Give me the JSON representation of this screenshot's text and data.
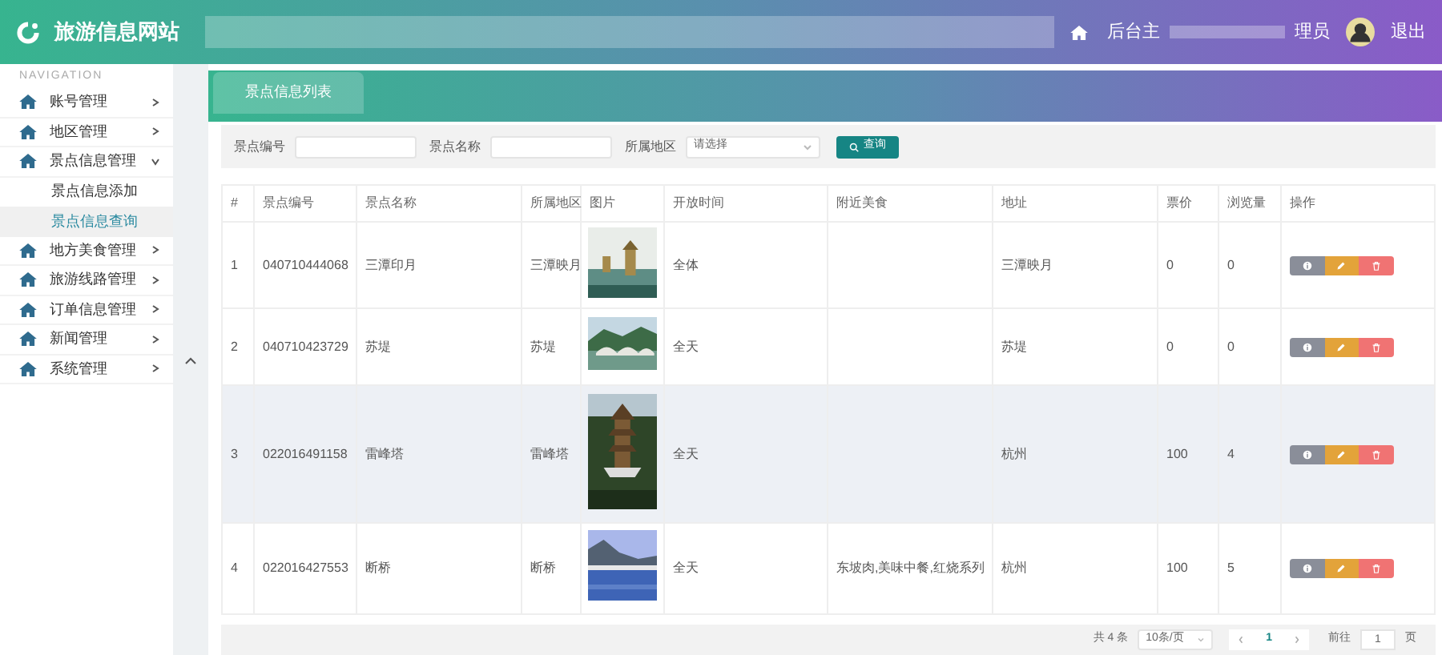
{
  "header": {
    "site_title": "旅游信息网站",
    "home_link": "后台主",
    "user_label": "理员",
    "logout": "退出"
  },
  "sidebar": {
    "heading": "NAVIGATION",
    "items": [
      {
        "label": "账号管理",
        "expanded": false
      },
      {
        "label": "地区管理",
        "expanded": false
      },
      {
        "label": "景点信息管理",
        "expanded": true,
        "children": [
          {
            "label": "景点信息添加",
            "selected": false
          },
          {
            "label": "景点信息查询",
            "selected": true
          }
        ]
      },
      {
        "label": "地方美食管理",
        "expanded": false
      },
      {
        "label": "旅游线路管理",
        "expanded": false
      },
      {
        "label": "订单信息管理",
        "expanded": false
      },
      {
        "label": "新闻管理",
        "expanded": false
      },
      {
        "label": "系统管理",
        "expanded": false
      }
    ]
  },
  "tabs": [
    {
      "label": "景点信息列表",
      "selected": true
    }
  ],
  "filters": [
    {
      "label": "景点编号",
      "kind": "text"
    },
    {
      "label": "景点名称",
      "kind": "text"
    },
    {
      "label": "所属地区",
      "kind": "select",
      "placeholder": "请选择"
    }
  ],
  "search_button": "查询",
  "table": {
    "columns": [
      "#",
      "景点编号",
      "景点名称",
      "所属地区",
      "图片",
      "开放时间",
      "附近美食",
      "地址",
      "票价",
      "浏览量",
      "操作"
    ],
    "rows": [
      {
        "index": "1",
        "code": "040710444068",
        "name": "三潭印月",
        "region": "三潭映月",
        "open": "全体",
        "address": "三潭映月",
        "price": "0",
        "views": "0",
        "hovered": false
      },
      {
        "index": "2",
        "code": "040710423729",
        "name": "苏堤",
        "region": "苏堤",
        "open": "全天",
        "address": "苏堤",
        "price": "0",
        "views": "0",
        "hovered": false
      },
      {
        "index": "3",
        "code": "022016491158",
        "name": "雷峰塔",
        "region": "雷峰塔",
        "open": "全天",
        "address": "杭州",
        "price": "100",
        "views": "4",
        "hovered": true
      },
      {
        "index": "4",
        "code": "022016427553",
        "name": "断桥",
        "region": "断桥",
        "open": "全天",
        "food": "东坡肉,美味中餐,红烧系列",
        "address": "杭州",
        "price": "100",
        "views": "5",
        "hovered": false
      }
    ]
  },
  "pagination": {
    "total": "共 4 条",
    "page_size": "10条/页",
    "pages": [
      {
        "label": "1",
        "selected": true
      }
    ],
    "goto_label": "前往",
    "goto_value": "1",
    "page_unit": "页"
  }
}
